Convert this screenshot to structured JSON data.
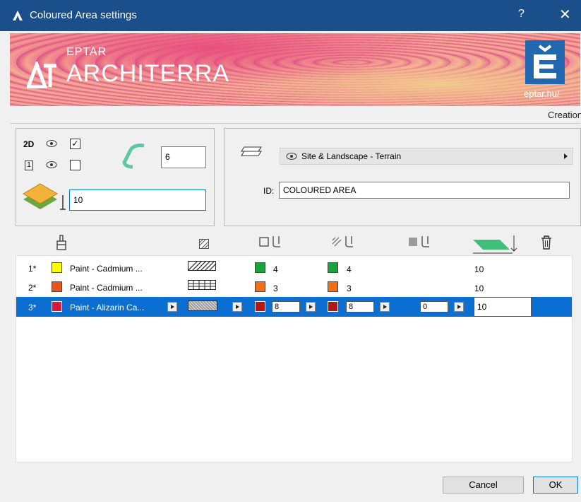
{
  "window": {
    "title": "Coloured Area settings",
    "help": "?",
    "close": "✕"
  },
  "banner": {
    "brand_small": "EPTAR",
    "brand_big": "ARCHITERRA",
    "eptar_url": "eptar.hu/"
  },
  "creation_label": "Creation",
  "left_panel": {
    "label_2d": "2D",
    "checked_2d": "✓",
    "label_3d": "1",
    "checked_3d": "",
    "segments_value": "6",
    "height_value": "10"
  },
  "right_panel": {
    "layer_value": "Site & Landscape - Terrain",
    "id_label": "ID:",
    "id_value": "COLOURED AREA"
  },
  "rows": [
    {
      "index": "1*",
      "color": "#ffff00",
      "name": "Paint - Cadmium ...",
      "pen1_color": "#1aa33a",
      "pen1": "4",
      "pen2_color": "#1aa33a",
      "pen2": "4",
      "height": "10"
    },
    {
      "index": "2*",
      "color": "#e8541a",
      "name": "Paint - Cadmium ...",
      "pen1_color": "#f07018",
      "pen1": "3",
      "pen2_color": "#f07018",
      "pen2": "3",
      "height": "10"
    },
    {
      "index": "3*",
      "color": "#d01d3d",
      "name": "Paint - Alizarin Ca...",
      "pen1_color": "#b01818",
      "pen1": "8",
      "pen2_color": "#b01818",
      "pen2": "8",
      "pen3": "0",
      "height": "10"
    }
  ],
  "buttons": {
    "cancel": "Cancel",
    "ok": "OK"
  }
}
